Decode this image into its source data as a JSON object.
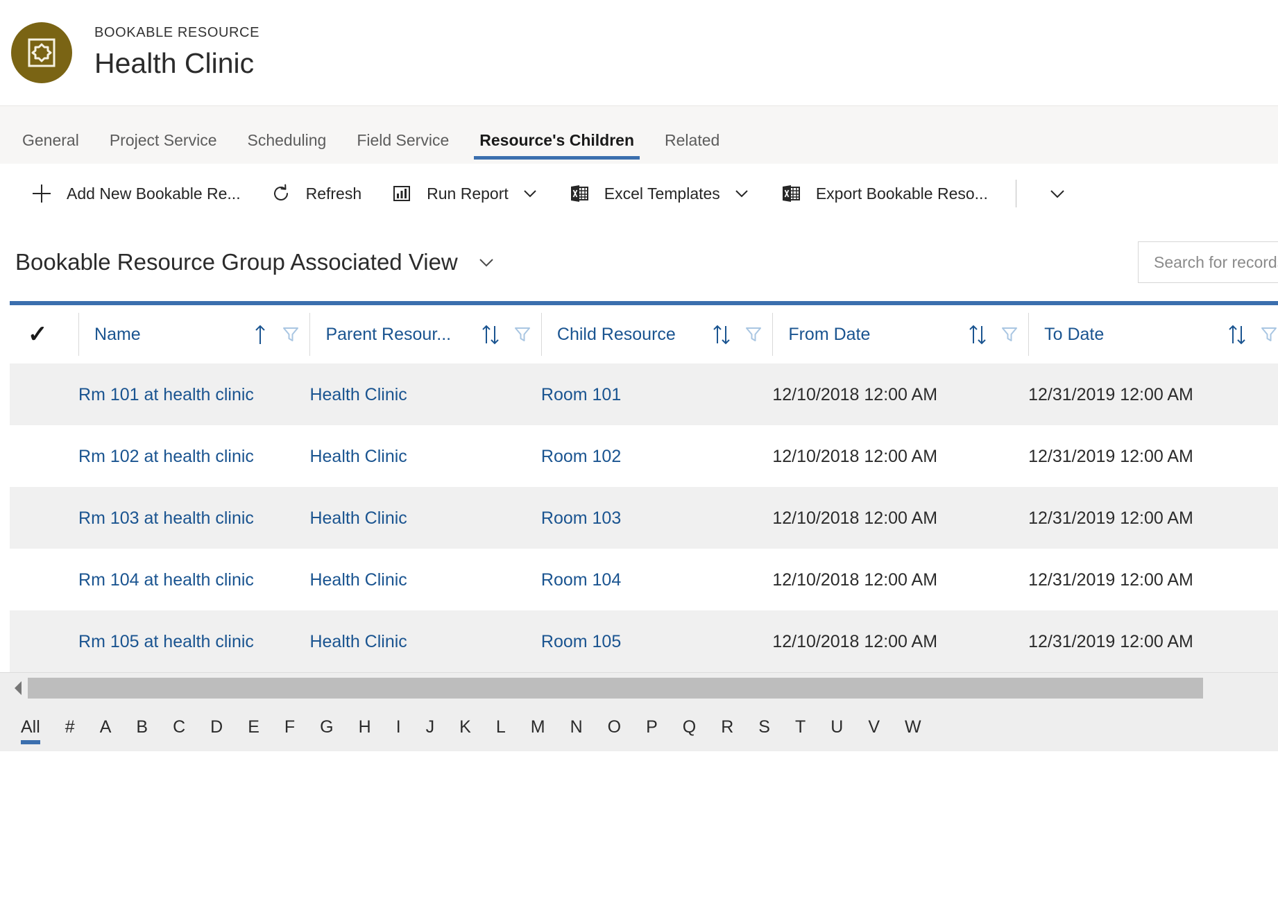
{
  "record_header": {
    "entity_label": "BOOKABLE RESOURCE",
    "record_name": "Health Clinic",
    "avatar_icon": "bookable-resource-icon",
    "avatar_color": "#7a6414"
  },
  "tabs": [
    {
      "label": "General",
      "active": false
    },
    {
      "label": "Project Service",
      "active": false
    },
    {
      "label": "Scheduling",
      "active": false
    },
    {
      "label": "Field Service",
      "active": false
    },
    {
      "label": "Resource's Children",
      "active": true
    },
    {
      "label": "Related",
      "active": false
    }
  ],
  "command_bar": {
    "items": [
      {
        "label": "Add New Bookable Re...",
        "icon": "plus-icon",
        "has_caret": false
      },
      {
        "label": "Refresh",
        "icon": "refresh-icon",
        "has_caret": false
      },
      {
        "label": "Run Report",
        "icon": "report-icon",
        "has_caret": true
      },
      {
        "label": "Excel Templates",
        "icon": "excel-icon",
        "has_caret": true
      },
      {
        "label": "Export Bookable Reso...",
        "icon": "excel-icon",
        "has_caret": false
      }
    ],
    "overflow_icon": "chevron-down-icon"
  },
  "view": {
    "title": "Bookable Resource Group Associated View",
    "selector_icon": "chevron-down-icon"
  },
  "search": {
    "placeholder": "Search for records",
    "value": ""
  },
  "grid": {
    "accent_color": "#3b6fae",
    "link_color": "#1a5490",
    "select_all_icon": "checkmark-icon",
    "columns": [
      {
        "label": "Name",
        "sort": "asc",
        "filter": true
      },
      {
        "label": "Parent Resour...",
        "sort": "none",
        "filter": true
      },
      {
        "label": "Child Resource",
        "sort": "none",
        "filter": true
      },
      {
        "label": "From Date",
        "sort": "none",
        "filter": true
      },
      {
        "label": "To Date",
        "sort": "none",
        "filter": true
      }
    ],
    "rows": [
      {
        "name": "Rm 101 at health clinic",
        "parent_resource": "Health Clinic",
        "child_resource": "Room 101",
        "from_date": "12/10/2018 12:00 AM",
        "to_date": "12/31/2019 12:00 AM"
      },
      {
        "name": "Rm 102 at health clinic",
        "parent_resource": "Health Clinic",
        "child_resource": "Room 102",
        "from_date": "12/10/2018 12:00 AM",
        "to_date": "12/31/2019 12:00 AM"
      },
      {
        "name": "Rm 103 at health clinic",
        "parent_resource": "Health Clinic",
        "child_resource": "Room 103",
        "from_date": "12/10/2018 12:00 AM",
        "to_date": "12/31/2019 12:00 AM"
      },
      {
        "name": "Rm 104 at health clinic",
        "parent_resource": "Health Clinic",
        "child_resource": "Room 104",
        "from_date": "12/10/2018 12:00 AM",
        "to_date": "12/31/2019 12:00 AM"
      },
      {
        "name": "Rm 105 at health clinic",
        "parent_resource": "Health Clinic",
        "child_resource": "Room 105",
        "from_date": "12/10/2018 12:00 AM",
        "to_date": "12/31/2019 12:00 AM"
      }
    ]
  },
  "footer": {
    "alpha_filters": [
      "All",
      "#",
      "A",
      "B",
      "C",
      "D",
      "E",
      "F",
      "G",
      "H",
      "I",
      "J",
      "K",
      "L",
      "M",
      "N",
      "O",
      "P",
      "Q",
      "R",
      "S",
      "T",
      "U",
      "V",
      "W"
    ],
    "selected_filter": "All"
  }
}
